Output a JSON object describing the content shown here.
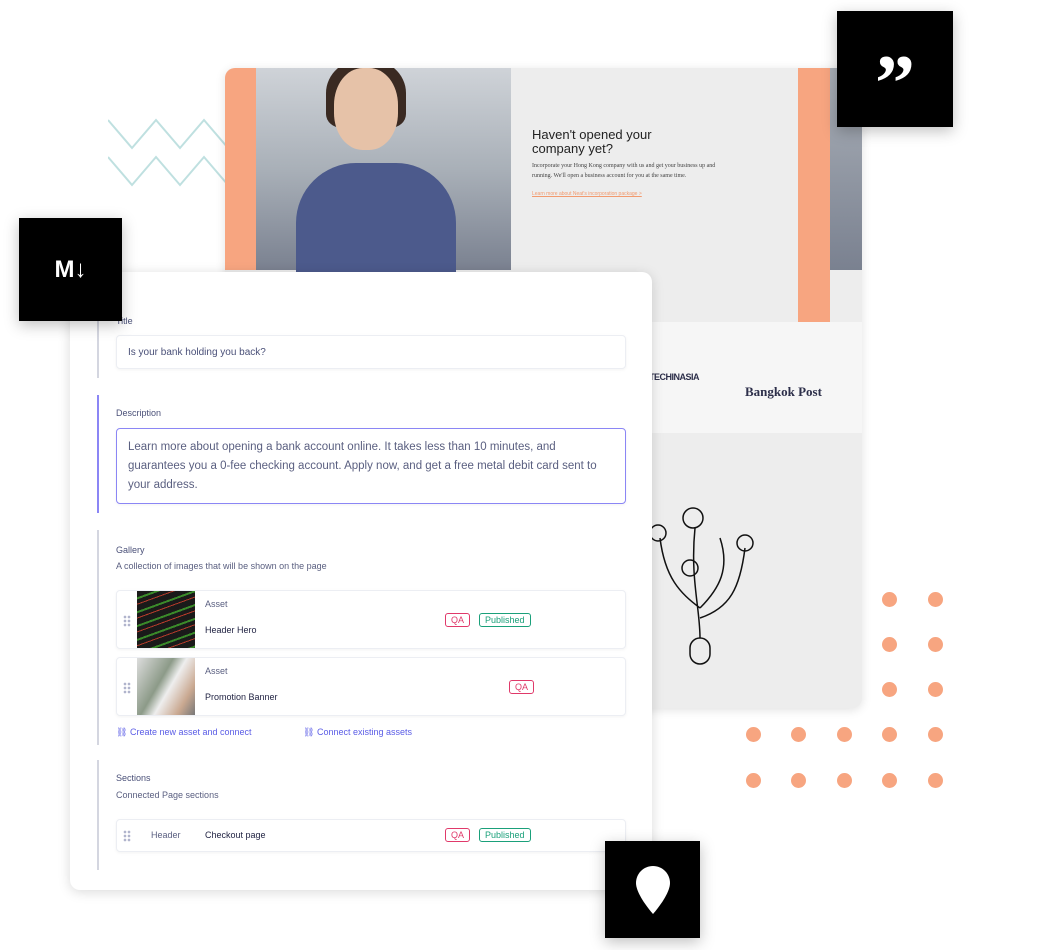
{
  "hero": {
    "title": "Haven't opened your company yet?",
    "text": "Incorporate your Hong Kong company with us and get your business up and running. We'll open a business account for you at the same time.",
    "link": "Learn more about Neat's incorporation package >"
  },
  "logos": [
    "TECHINASIA",
    "Bangkok Post"
  ],
  "form": {
    "title_label": "Title",
    "title_value": "Is your bank holding you back?",
    "description_label": "Description",
    "description_value": "Learn more about opening a bank account online. It takes less than 10 minutes, and guarantees you a 0-fee checking account. Apply now, and get a free metal debit card sent to your address.",
    "gallery_label": "Gallery",
    "gallery_sub": "A collection of images that will be shown on the page",
    "gallery": [
      {
        "kind": "Asset",
        "name": "Header Hero",
        "badges": [
          "QA",
          "Published"
        ]
      },
      {
        "kind": "Asset",
        "name": "Promotion Banner",
        "badges": [
          "QA"
        ]
      }
    ],
    "create_link": "Create new asset and connect",
    "connect_link": "Connect existing assets",
    "sections_label": "Sections",
    "sections_sub": "Connected Page sections",
    "sections": [
      {
        "kind": "Header",
        "name": "Checkout page",
        "badges": [
          "QA",
          "Published"
        ]
      }
    ]
  },
  "icons": [
    "quote-icon",
    "markdown-icon",
    "location-pin-icon",
    "link-icon",
    "drag-handle-icon"
  ],
  "colors": {
    "accent": "#f7a580",
    "focus": "#8b86f5",
    "qa": "#e0396a",
    "published": "#1aa07a",
    "zigzag": "#bfe0e0"
  }
}
